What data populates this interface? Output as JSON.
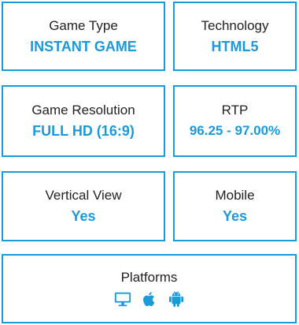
{
  "accent_color": "#1a9ad9",
  "cards": [
    {
      "label": "Game Type",
      "value": "INSTANT GAME"
    },
    {
      "label": "Technology",
      "value": "HTML5"
    },
    {
      "label": "Game Resolution",
      "value": "FULL HD (16:9)"
    },
    {
      "label": "RTP",
      "value": "96.25 - 97.00%"
    },
    {
      "label": "Vertical View",
      "value": "Yes"
    },
    {
      "label": "Mobile",
      "value": "Yes"
    }
  ],
  "platforms": {
    "label": "Platforms",
    "icons": [
      "desktop-icon",
      "apple-icon",
      "android-icon"
    ]
  }
}
